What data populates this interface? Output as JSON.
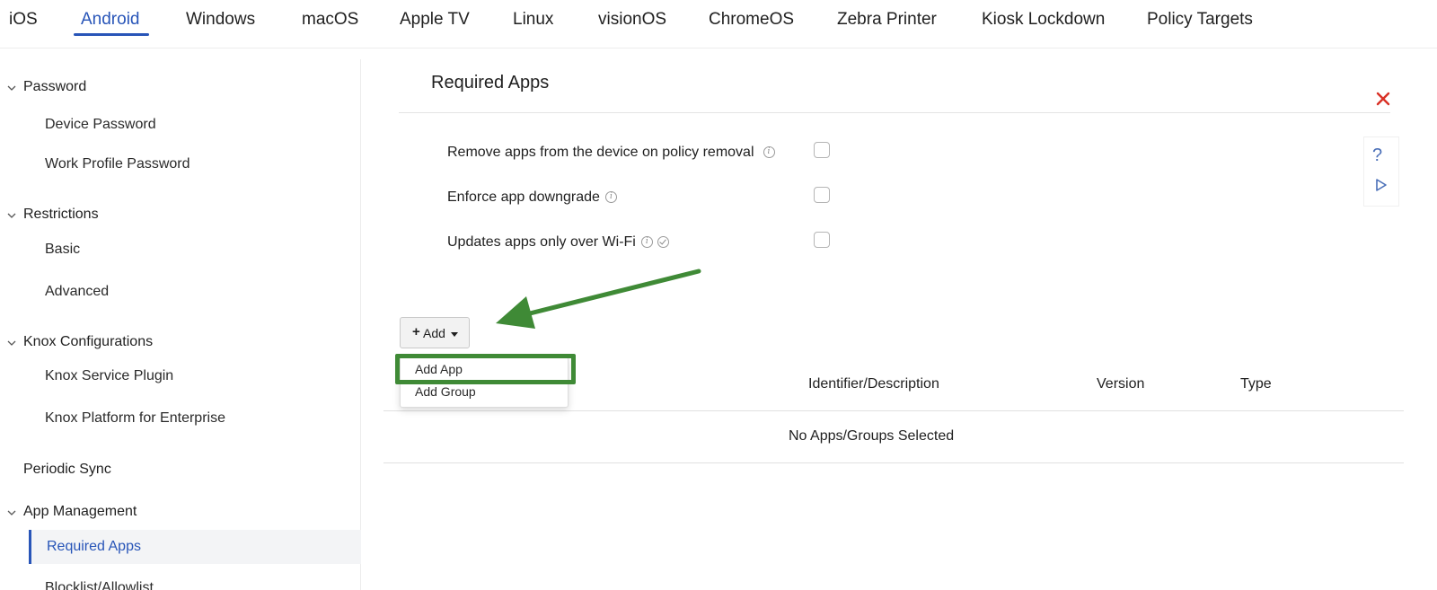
{
  "tabs": [
    {
      "label": "iOS"
    },
    {
      "label": "Android"
    },
    {
      "label": "Windows"
    },
    {
      "label": "macOS"
    },
    {
      "label": "Apple TV"
    },
    {
      "label": "Linux"
    },
    {
      "label": "visionOS"
    },
    {
      "label": "ChromeOS"
    },
    {
      "label": "Zebra Printer"
    },
    {
      "label": "Kiosk Lockdown"
    },
    {
      "label": "Policy Targets"
    }
  ],
  "active_tab": "Android",
  "sidebar": {
    "groups": [
      {
        "label": "Password",
        "items": [
          "Device Password",
          "Work Profile Password"
        ]
      },
      {
        "label": "Restrictions",
        "items": [
          "Basic",
          "Advanced"
        ]
      },
      {
        "label": "Knox Configurations",
        "items": [
          "Knox Service Plugin",
          "Knox Platform for Enterprise"
        ]
      },
      {
        "label": "Periodic Sync",
        "items": []
      },
      {
        "label": "App Management",
        "items": [
          "Required Apps",
          "Blocklist/Allowlist"
        ]
      }
    ],
    "active_item": "Required Apps"
  },
  "panel": {
    "title": "Required Apps",
    "options": [
      {
        "label": "Remove apps from the device on policy removal",
        "checked": false
      },
      {
        "label": "Enforce app downgrade",
        "checked": false
      },
      {
        "label": "Updates apps only over Wi-Fi",
        "checked": false
      }
    ],
    "help_label": "?",
    "add_button": {
      "plus": "+",
      "label": "Add"
    },
    "dropdown": [
      "Add App",
      "Add Group"
    ],
    "table": {
      "headers": [
        "Identifier/Description",
        "Version",
        "Type"
      ],
      "empty_message": "No Apps/Groups Selected"
    }
  },
  "colors": {
    "accent": "#2855b8",
    "close": "#d93025",
    "highlight": "#3f8a36"
  },
  "icons": [
    "chevron-down-icon",
    "close-icon",
    "help-icon",
    "play-icon",
    "info-icon",
    "check-circle-icon",
    "plus-icon",
    "caret-down-icon",
    "annotation-arrow"
  ]
}
